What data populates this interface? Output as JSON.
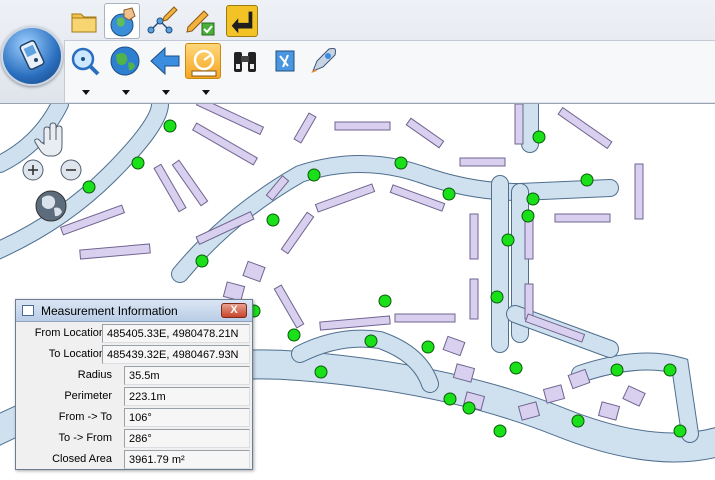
{
  "toolbar": {
    "tabs": [
      {
        "icon": "folder-icon"
      },
      {
        "icon": "map-tools-icon"
      },
      {
        "icon": "edit-network-icon"
      },
      {
        "icon": "edit-confirm-icon"
      },
      {
        "icon": "back-arrow-icon"
      }
    ],
    "tools": [
      {
        "icon": "zoom-icon",
        "dropdown": true
      },
      {
        "icon": "globe-icon",
        "dropdown": true
      },
      {
        "icon": "back-icon",
        "dropdown": true
      },
      {
        "icon": "measure-icon",
        "dropdown": true
      },
      {
        "icon": "binoculars-icon",
        "dropdown": false
      },
      {
        "icon": "bookmark-icon",
        "dropdown": false
      },
      {
        "icon": "rocket-icon",
        "dropdown": false
      }
    ]
  },
  "map": {
    "colors": {
      "road": "#cfe0ee",
      "road_edge": "#4f6f8f",
      "building": "#d8d0ee",
      "building_edge": "#6f6490",
      "point": "#19e019"
    }
  },
  "dialog": {
    "title": "Measurement Information",
    "close": "X",
    "rows": [
      {
        "label": "From Location",
        "value": "485405.33E, 4980478.21N"
      },
      {
        "label": "To Location",
        "value": "485439.32E, 4980467.93N"
      },
      {
        "label": "Radius",
        "value": "35.5m"
      },
      {
        "label": "Perimeter",
        "value": "223.1m"
      },
      {
        "label": "From -> To",
        "value": "106°"
      },
      {
        "label": "To -> From",
        "value": "286°"
      },
      {
        "label": "Closed Area",
        "value": "3961.79 m²"
      }
    ]
  }
}
